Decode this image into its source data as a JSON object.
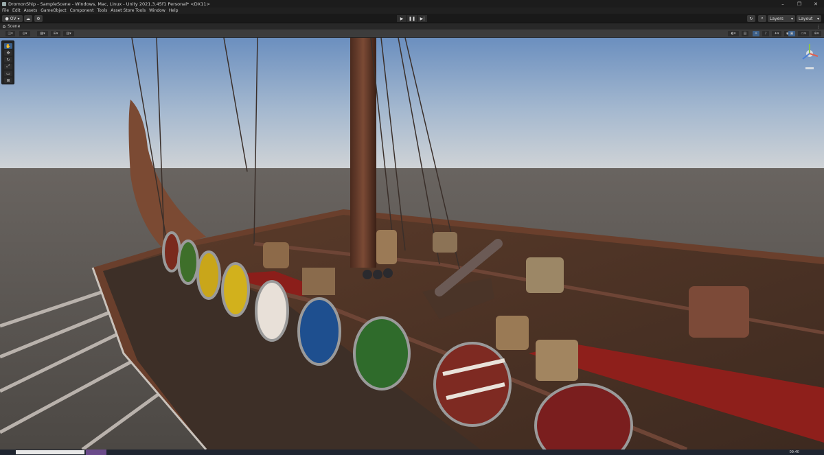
{
  "window": {
    "title": "DromonShip - SampleScene - Windows, Mac, Linux - Unity 2021.3.45f1 Personal* <DX11>"
  },
  "menu": {
    "items": [
      "File",
      "Edit",
      "Assets",
      "GameObject",
      "Component",
      "Tools",
      "Asset Store Tools",
      "Window",
      "Help"
    ]
  },
  "toolbar": {
    "account_label": "OV",
    "layers_label": "Layers",
    "layout_label": "Layout"
  },
  "scene_tab": {
    "label": "Scene"
  },
  "taskbar": {
    "time": "09:40"
  },
  "colors": {
    "sky_top": "#6f93c2",
    "sky_horizon": "#c4ccd4",
    "sea": "#595450",
    "hull": "#6a3f2c",
    "deck": "#7a5037",
    "active_tool": "#3b5f8a"
  },
  "icons": [
    "move-tool-icon",
    "rotate-tool-icon",
    "scale-tool-icon",
    "rect-tool-icon",
    "transform-tool-icon",
    "view-tool-icon",
    "play-icon",
    "pause-icon",
    "step-icon",
    "cloud-icon",
    "search-icon",
    "history-icon"
  ]
}
